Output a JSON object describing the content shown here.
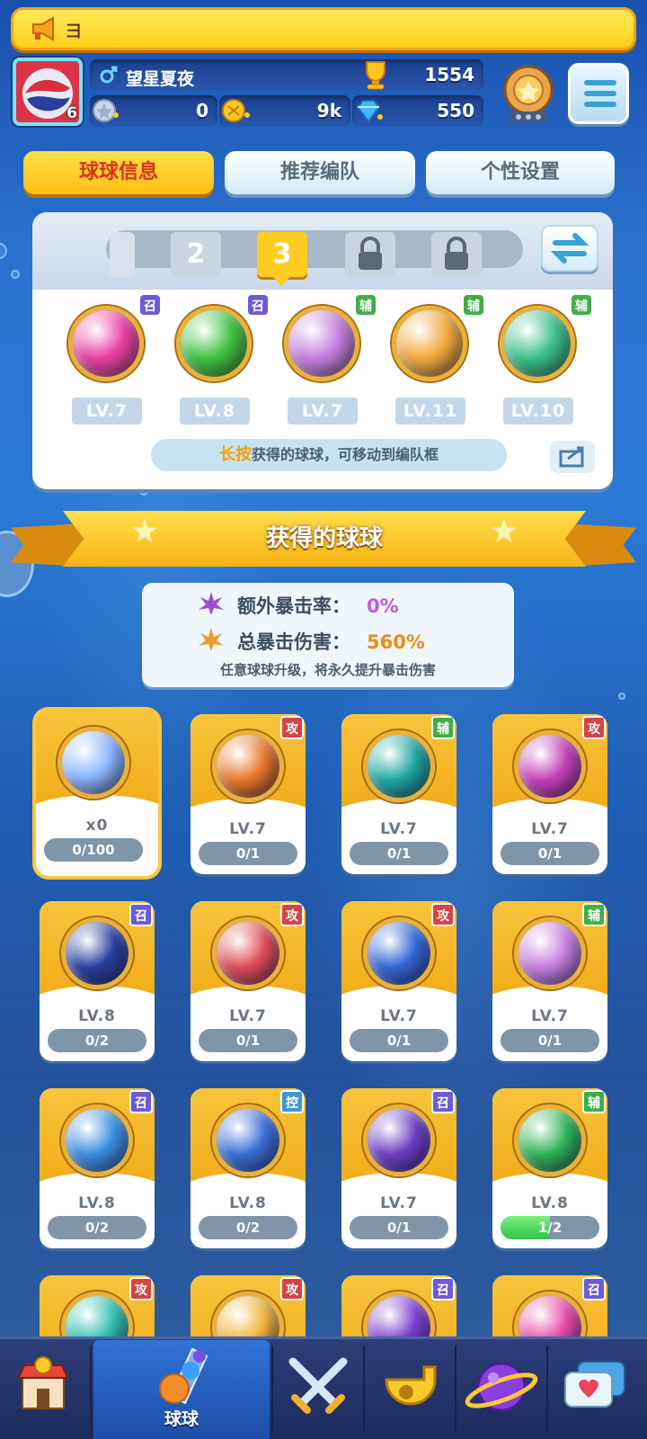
{
  "notice": {
    "text": "彐"
  },
  "profile": {
    "level": "6",
    "name": "望星夏夜",
    "trophies": "1554",
    "stamina": "0",
    "coins": "9k",
    "gems": "550"
  },
  "tabs": [
    {
      "label": "球球信息",
      "active": true
    },
    {
      "label": "推荐编队",
      "active": false
    },
    {
      "label": "个性设置",
      "active": false
    }
  ],
  "team": {
    "slots": [
      "1",
      "2",
      "3",
      "locked",
      "locked"
    ],
    "selected_slot": "3",
    "balls": [
      {
        "badge": "召",
        "level": "LV.7",
        "color": "#e93fa3"
      },
      {
        "badge": "召",
        "level": "LV.8",
        "color": "#3fc23f"
      },
      {
        "badge": "辅",
        "level": "LV.7",
        "color": "#c47ee0"
      },
      {
        "badge": "辅",
        "level": "LV.11",
        "color": "#f3a73a"
      },
      {
        "badge": "辅",
        "level": "LV.10",
        "color": "#39c08a"
      }
    ],
    "tip_highlight": "长按",
    "tip_text": "获得的球球，可移动到编队框"
  },
  "section": {
    "title": "获得的球球"
  },
  "stats": {
    "crit_rate_label": "额外暴击率：",
    "crit_rate": "0%",
    "crit_damage_label": "总暴击伤害：",
    "crit_damage": "560%",
    "note": "任意球球升级，将永久提升暴击伤害"
  },
  "cards": [
    {
      "special": true,
      "level": "x0",
      "progress": "0/100",
      "fill": 0,
      "color": "#8db7ff"
    },
    {
      "badge": "攻",
      "level": "LV.7",
      "progress": "0/1",
      "fill": 0,
      "color": "#e8762a"
    },
    {
      "badge": "辅",
      "level": "LV.7",
      "progress": "0/1",
      "fill": 0,
      "color": "#1fa6a0"
    },
    {
      "badge": "攻",
      "level": "LV.7",
      "progress": "0/1",
      "fill": 0,
      "color": "#c43fb8"
    },
    {
      "badge": "召",
      "level": "LV.8",
      "progress": "0/2",
      "fill": 0,
      "color": "#2a3f9e"
    },
    {
      "badge": "攻",
      "level": "LV.7",
      "progress": "0/1",
      "fill": 0,
      "color": "#e04c57"
    },
    {
      "badge": "攻",
      "level": "LV.7",
      "progress": "0/1",
      "fill": 0,
      "color": "#3466d6"
    },
    {
      "badge": "辅",
      "level": "LV.7",
      "progress": "0/1",
      "fill": 0,
      "color": "#c47ee0"
    },
    {
      "badge": "召",
      "level": "LV.8",
      "progress": "0/2",
      "fill": 0,
      "color": "#3d8fe0"
    },
    {
      "badge": "控",
      "level": "LV.8",
      "progress": "0/2",
      "fill": 0,
      "color": "#3a6fd6"
    },
    {
      "badge": "召",
      "level": "LV.7",
      "progress": "0/1",
      "fill": 0,
      "color": "#6b3fc2"
    },
    {
      "badge": "辅",
      "level": "LV.8",
      "progress": "1/2",
      "fill": 0.5,
      "color": "#2fb457"
    },
    {
      "badge": "攻",
      "level": "",
      "progress": "",
      "fill": 0,
      "color": "#2ec0b0"
    },
    {
      "badge": "攻",
      "level": "",
      "progress": "",
      "fill": 0,
      "color": "#f2b33a"
    },
    {
      "badge": "召",
      "level": "",
      "progress": "",
      "fill": 0,
      "color": "#7a3fd0"
    },
    {
      "badge": "召",
      "level": "",
      "progress": "",
      "fill": 0,
      "color": "#e64aa8"
    }
  ],
  "nav": [
    {
      "name": "shop",
      "label": ""
    },
    {
      "name": "balls",
      "label": "球球",
      "active": true
    },
    {
      "name": "battle",
      "label": ""
    },
    {
      "name": "coop",
      "label": ""
    },
    {
      "name": "planet",
      "label": ""
    },
    {
      "name": "social",
      "label": ""
    }
  ]
}
